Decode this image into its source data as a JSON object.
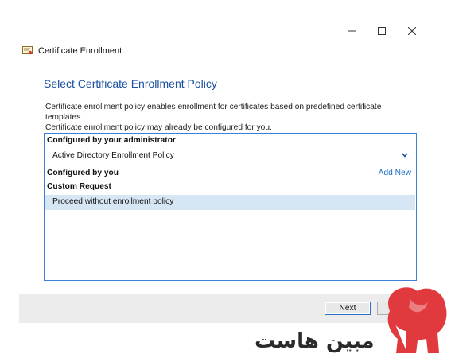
{
  "window": {
    "title": "Certificate Enrollment",
    "controls": {
      "minimize": "—",
      "maximize": "☐",
      "close": "✕"
    }
  },
  "page": {
    "heading": "Select Certificate Enrollment Policy",
    "description_line1": "Certificate enrollment policy enables enrollment for certificates based on predefined certificate templates.",
    "description_line2": "Certificate enrollment policy may already be configured for you."
  },
  "policy_list": {
    "admin_header": "Configured by your administrator",
    "admin_item": "Active Directory Enrollment Policy",
    "user_header": "Configured by you",
    "add_new": "Add New",
    "custom_header": "Custom Request",
    "custom_item": "Proceed without enrollment policy"
  },
  "footer": {
    "next_label": "Next"
  },
  "watermark": {
    "text": "مبین هاست",
    "brand_color": "#e03a3e"
  },
  "colors": {
    "heading": "#1a4fa0",
    "link": "#1a6fc4",
    "selection": "#d6e6f5",
    "border_accent": "#3d7fd6"
  }
}
